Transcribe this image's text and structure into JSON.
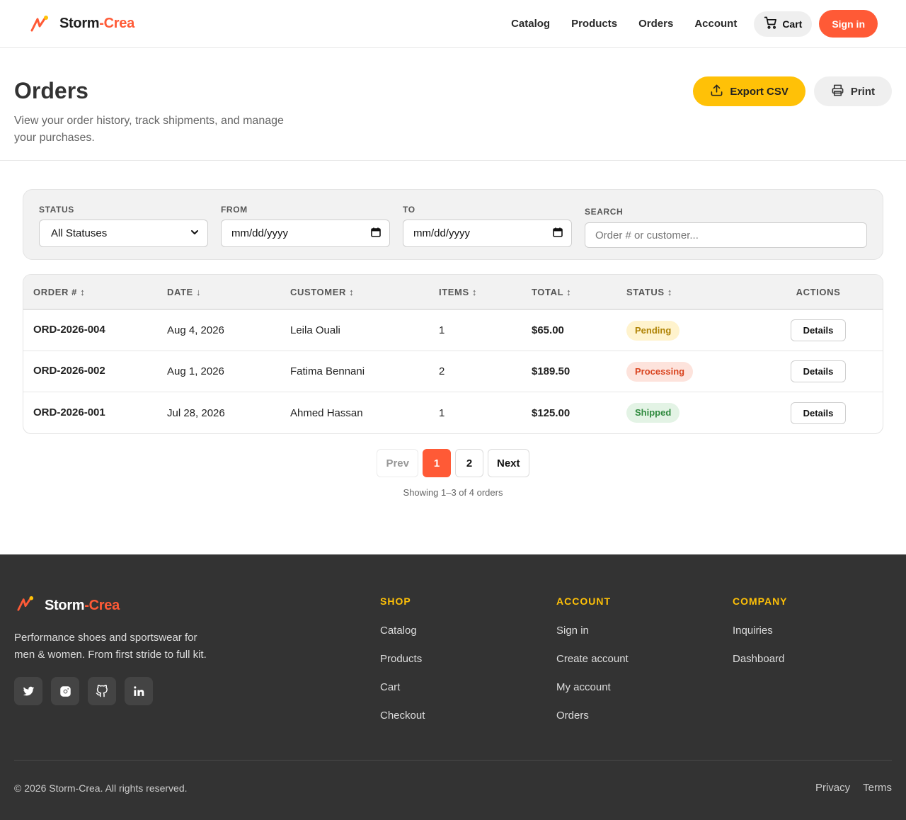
{
  "header": {
    "brand_part1": "Storm",
    "brand_part2": "-Crea",
    "nav": [
      "Catalog",
      "Products",
      "Orders",
      "Account"
    ],
    "cart_label": "Cart",
    "signin_label": "Sign in"
  },
  "page": {
    "title": "Orders",
    "subtitle": "View your order history, track shipments, and manage your purchases.",
    "export_label": "Export CSV",
    "print_label": "Print"
  },
  "filters": {
    "status_label": "STATUS",
    "status_value": "All Statuses",
    "from_label": "FROM",
    "from_value": "mm/dd/yyyy",
    "to_label": "TO",
    "to_value": "mm/dd/yyyy",
    "search_label": "SEARCH",
    "search_placeholder": "Order # or customer..."
  },
  "table": {
    "columns": [
      "ORDER # ↕",
      "DATE ↓",
      "CUSTOMER ↕",
      "ITEMS ↕",
      "TOTAL ↕",
      "STATUS ↕",
      "ACTIONS"
    ],
    "rows": [
      {
        "order": "ORD-2026-004",
        "date": "Aug 4, 2026",
        "customer": "Leila Ouali",
        "items": "1",
        "total": "$65.00",
        "status": "Pending",
        "action": "Details"
      },
      {
        "order": "ORD-2026-002",
        "date": "Aug 1, 2026",
        "customer": "Fatima Bennani",
        "items": "2",
        "total": "$189.50",
        "status": "Processing",
        "action": "Details"
      },
      {
        "order": "ORD-2026-001",
        "date": "Jul 28, 2026",
        "customer": "Ahmed Hassan",
        "items": "1",
        "total": "$125.00",
        "status": "Shipped",
        "action": "Details"
      }
    ]
  },
  "status_colors": {
    "Pending": {
      "bg": "#fff3cd",
      "fg": "#b08407"
    },
    "Processing": {
      "bg": "#fde3dc",
      "fg": "#d9441f"
    },
    "Shipped": {
      "bg": "#e3f3e5",
      "fg": "#2f8a3e"
    }
  },
  "pagination": {
    "prev": "Prev",
    "pages": [
      "1",
      "2"
    ],
    "active": "1",
    "next": "Next",
    "showing": "Showing 1–3 of 4 orders"
  },
  "footer": {
    "brand_part1": "Storm",
    "brand_part2": "-Crea",
    "description": "Performance shoes and sportswear for men & women. From first stride to full kit.",
    "socials": [
      "twitter-icon",
      "instagram-icon",
      "github-icon",
      "linkedin-icon"
    ],
    "shop": {
      "title": "SHOP",
      "links": [
        "Catalog",
        "Products",
        "Cart",
        "Checkout"
      ]
    },
    "account": {
      "title": "ACCOUNT",
      "links": [
        "Sign in",
        "Create account",
        "My account",
        "Orders"
      ]
    },
    "company": {
      "title": "COMPANY",
      "links": [
        "Inquiries",
        "Dashboard"
      ]
    },
    "copyright": "© 2026 Storm-Crea. All rights reserved.",
    "legal": [
      "Privacy",
      "Terms"
    ]
  },
  "colors": {
    "accent": "#ff5a36",
    "highlight": "#ffc107",
    "footer_bg": "#333333"
  }
}
